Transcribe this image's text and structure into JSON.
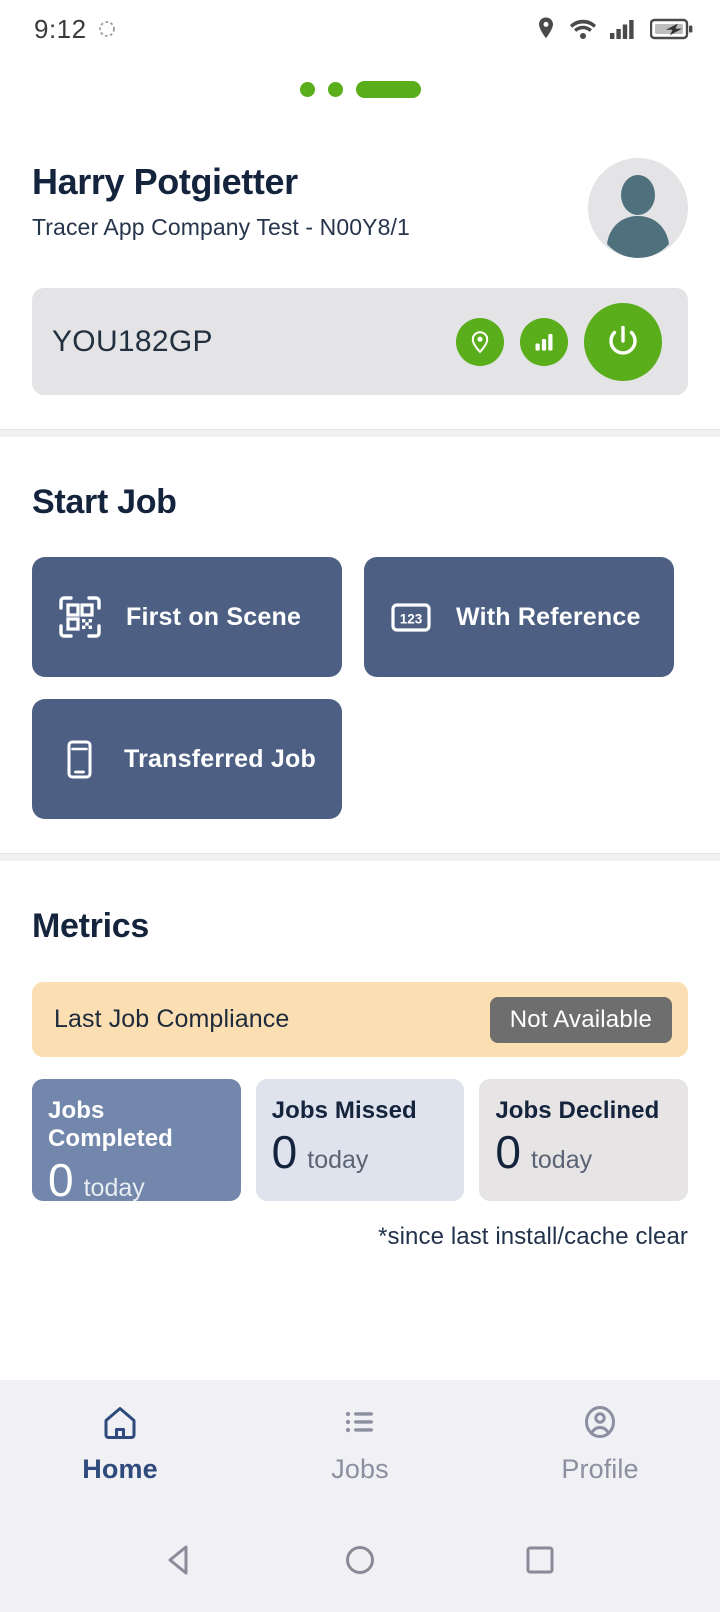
{
  "status_bar": {
    "time": "9:12",
    "icons": [
      "refresh-icon",
      "location-icon",
      "wifi-icon",
      "cellular-signal-icon",
      "battery-charging-icon"
    ]
  },
  "pager": {
    "total": 3,
    "active_index": 2
  },
  "header": {
    "user_name": "Harry Potgietter",
    "company": "Tracer App Company Test - N00Y8/1",
    "avatar_alt": "avatar",
    "vehicle": {
      "registration": "YOU182GP",
      "actions": [
        {
          "name": "location-icon",
          "label": "Location"
        },
        {
          "name": "signal-icon",
          "label": "Signal"
        },
        {
          "name": "power-icon",
          "label": "Power"
        }
      ]
    }
  },
  "start_job": {
    "title": "Start Job",
    "buttons": [
      {
        "label": "First on Scene",
        "icon": "qr-scan-icon"
      },
      {
        "label": "With Reference",
        "icon": "numeric-123-icon"
      },
      {
        "label": "Transferred Job",
        "icon": "smartphone-icon"
      }
    ]
  },
  "metrics": {
    "title": "Metrics",
    "compliance": {
      "label": "Last Job Compliance",
      "status": "Not Available"
    },
    "cards": [
      {
        "title": "Jobs Completed",
        "value": "0",
        "unit": "today"
      },
      {
        "title": "Jobs Missed",
        "value": "0",
        "unit": "today"
      },
      {
        "title": "Jobs Declined",
        "value": "0",
        "unit": "today"
      }
    ],
    "footnote": "*since last install/cache clear"
  },
  "tabs": [
    {
      "label": "Home",
      "icon": "home-icon",
      "active": true
    },
    {
      "label": "Jobs",
      "icon": "list-icon",
      "active": false
    },
    {
      "label": "Profile",
      "icon": "account-circle-icon",
      "active": false
    }
  ],
  "android_nav": [
    {
      "name": "back-button",
      "icon": "triangle-left-icon"
    },
    {
      "name": "home-button",
      "icon": "circle-icon"
    },
    {
      "name": "recents-button",
      "icon": "square-icon"
    }
  ],
  "colors": {
    "green": "#5aad1b",
    "slate": "#4d6084",
    "navy": "#15243d",
    "amber": "#fbdfb2",
    "gray_badge": "#6e6e6e"
  }
}
